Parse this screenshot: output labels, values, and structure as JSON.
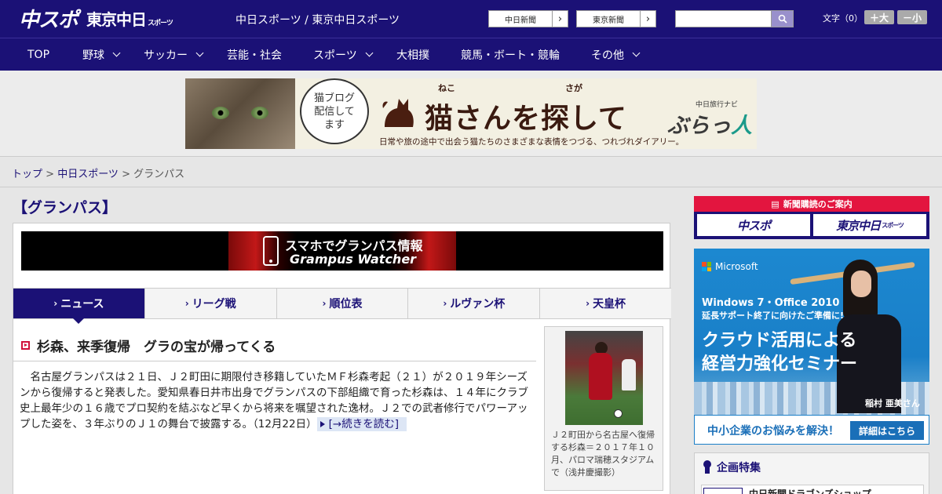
{
  "header": {
    "logo_main": "中スポ",
    "logo_tokyo": "東京中日",
    "logo_tokyo_sub": "スポーツ",
    "site_title": "中日スポーツ / 東京中日スポーツ",
    "ext_links": [
      "中日新聞",
      "東京新聞"
    ],
    "search_placeholder": "",
    "font_size_label": "文字（0）",
    "font_bigger": "＋大",
    "font_smaller": "－小"
  },
  "nav": {
    "items": [
      {
        "label": "TOP",
        "dropdown": false
      },
      {
        "label": "野球",
        "dropdown": true
      },
      {
        "label": "サッカー",
        "dropdown": true
      },
      {
        "label": "芸能・社会",
        "dropdown": false
      },
      {
        "label": "スポーツ",
        "dropdown": true
      },
      {
        "label": "大相撲",
        "dropdown": false
      },
      {
        "label": "競馬・ボート・競輪",
        "dropdown": false
      },
      {
        "label": "その他",
        "dropdown": true
      }
    ]
  },
  "banner": {
    "bubble_text": "猫ブログ配信してます",
    "headline": "猫さんを探して",
    "furigana_1": "ねこ",
    "furigana_2": "さが",
    "subline": "日常や旅の途中で出会う猫たちのさまざまな表情をつづる、つれづれダイアリー。",
    "brand_small": "中日旅行ナビ",
    "brand_main": "ぶらっ",
    "brand_accent": "人"
  },
  "breadcrumb": {
    "items": [
      "トップ",
      "中日スポーツ",
      "グランパス"
    ],
    "separator": " > "
  },
  "page": {
    "heading": "【グランパス】"
  },
  "promo": {
    "line1": "スマホでグランパス情報",
    "line2": "Grampus Watcher"
  },
  "tabs": [
    {
      "label": "ニュース",
      "active": true
    },
    {
      "label": "リーグ戦",
      "active": false
    },
    {
      "label": "順位表",
      "active": false
    },
    {
      "label": "ルヴァン杯",
      "active": false
    },
    {
      "label": "天皇杯",
      "active": false
    }
  ],
  "article": {
    "title": "杉森、来季復帰　グラの宝が帰ってくる",
    "body": "名古屋グランパスは２１日、Ｊ２町田に期限付き移籍していたＭＦ杉森考起（２１）が２０１９年シーズンから復帰すると発表した。愛知県春日井市出身でグランパスの下部組織で育った杉森は、１４年にクラブ史上最年少の１６歳でプロ契約を結ぶなど早くから将来を嘱望された逸材。Ｊ２での武者修行でパワーアップした姿を、３年ぶりのＪ１の舞台で披露する。",
    "date": "（12月22日）",
    "read_more": "[→続きを読む]",
    "photo_caption": "Ｊ２町田から名古屋へ復帰する杉森＝２０１７年１０月、パロマ瑞穂スタジアムで（浅井慶撮影）"
  },
  "sidebar": {
    "subscription_head": "新聞購読のご案内",
    "subscription_btns": [
      "中スポ",
      "東京中日"
    ],
    "subscription_btn_sub": "スポーツ",
    "ad": {
      "brand": "Microsoft",
      "line1": "Windows 7・Office 2010",
      "line2": "延長サポート終了に向けたご準備に!",
      "line3a": "クラウド活用による",
      "line3b": "経営力強化セミナー",
      "person": "稲村 亜美さん",
      "cta": "中小企業のお悩みを解決！",
      "cta_button": "詳細はこちら"
    },
    "feature_title": "企画特集",
    "feature_item": "中日新聞ドラゴンズショップ"
  },
  "colors": {
    "brand_navy": "#1b1176",
    "accent_red": "#e3153f",
    "ad_blue": "#1a7fc8"
  }
}
